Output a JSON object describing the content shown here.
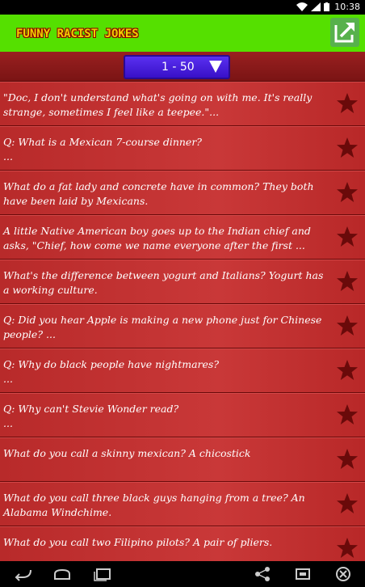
{
  "status": {
    "time": "10:38"
  },
  "app": {
    "title": "FUNNY RACIST JOKES"
  },
  "selector": {
    "value": "1 - 50"
  },
  "jokes": [
    "\"Doc, I don't understand what's going on with me. It's really strange, sometimes I feel like a teepee.\"...",
    "Q: What is a Mexican 7-course dinner?\n...",
    "What do a fat lady and concrete have in common? They both have been laid by Mexicans.",
    "A little Native American boy goes up to the Indian chief and asks, \"Chief, how come we name everyone after the first ...",
    "What's the difference between yogurt and Italians? Yogurt has a working culture.",
    "Q: Did you hear Apple is making a new phone just for Chinese people? ...",
    "Q: Why do black people have nightmares?\n...",
    "Q: Why can't Stevie Wonder read?\n...",
    "What do you call a skinny mexican? A chicostick",
    "What do you call three black guys hanging from a tree? An Alabama Windchime.",
    "What do you call two Filipino pilots? A pair of pliers."
  ],
  "icons": {
    "share": "share-icon",
    "favorite": "star-icon"
  },
  "colors": {
    "appbar": "#55e000",
    "list_bg": "#b82a2a",
    "selector": "#4a20e0",
    "star": "#6a0a0a"
  }
}
